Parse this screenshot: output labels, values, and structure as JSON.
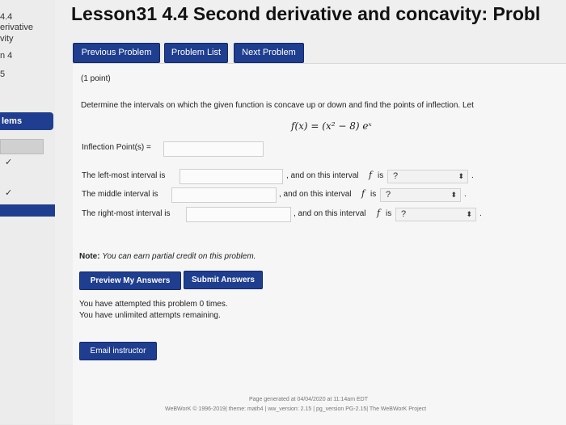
{
  "sidebar": {
    "section_number": "4.4",
    "line2": "erivative",
    "line3": "vity",
    "line4": "n 4",
    "line5": "5",
    "problems_label": "lems",
    "check_mark": "✓"
  },
  "header": {
    "title": "Lesson31 4.4 Second derivative and concavity: Probl"
  },
  "nav": {
    "previous": "Previous Problem",
    "list": "Problem List",
    "next": "Next Problem"
  },
  "problem": {
    "points": "(1 point)",
    "instructions": "Determine the intervals on which the given function is concave up or down and find the points of inflection. Let",
    "function_display": "f(x) = (x² − 8) eˣ",
    "inflection_label": "Inflection Point(s) =",
    "inflection_value": "",
    "rows": [
      {
        "label": "The left-most interval is",
        "value": "",
        "mid": ", and on this interval",
        "f": "f",
        "is": "is",
        "selected": "?"
      },
      {
        "label": "The middle interval is",
        "value": "",
        "mid": ", and on this interval",
        "f": "f",
        "is": "is",
        "selected": "?"
      },
      {
        "label": "The right-most interval is",
        "value": "",
        "mid": ", and on this interval",
        "f": "f",
        "is": "is",
        "selected": "?"
      }
    ],
    "dot": "."
  },
  "note": {
    "label": "Note:",
    "text": "You can earn partial credit on this problem."
  },
  "actions": {
    "preview": "Preview My Answers",
    "submit": "Submit Answers"
  },
  "attempts": {
    "line1": "You have attempted this problem 0 times.",
    "line2": "You have unlimited attempts remaining."
  },
  "email_button": "Email instructor",
  "footer": {
    "line1": "Page generated at 04/04/2020 at 11:14am EDT",
    "line2": "WeBWorK © 1996-2019| theme: math4 | ww_version: 2.15 | pg_version PG-2.15| The WeBWorK Project"
  }
}
